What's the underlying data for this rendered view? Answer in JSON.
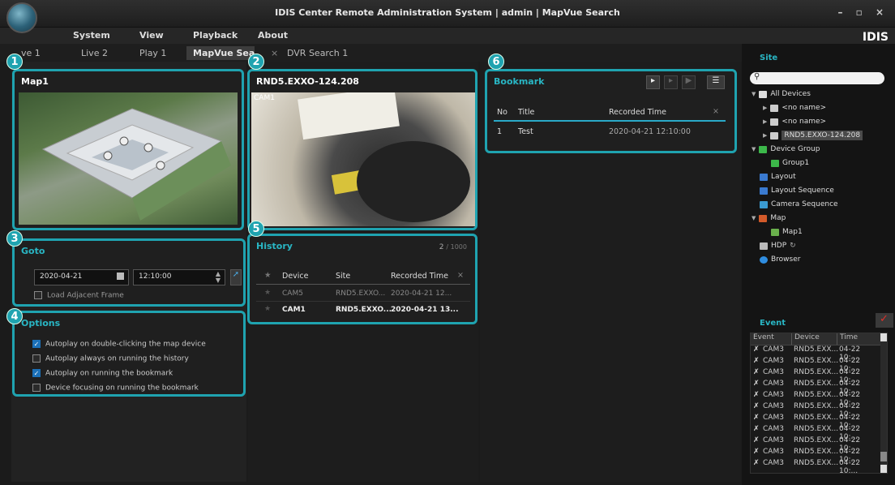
{
  "window": {
    "title": "IDIS Center Remote Administration System | admin | MapVue Search",
    "controls": "– ▫ ×"
  },
  "menu": {
    "items": [
      "System",
      "View",
      "Playback",
      "About"
    ],
    "brand": "IDIS"
  },
  "tabs": [
    {
      "label": "ve 1"
    },
    {
      "label": "Live 2"
    },
    {
      "label": "Play 1"
    },
    {
      "label": "MapVue Search"
    },
    {
      "label": "DVR Search 1"
    }
  ],
  "close_tab_glyph": "×",
  "map_panel": {
    "title": "Map1",
    "badge": "1"
  },
  "camera_panel": {
    "title": "RND5.EXXO-124.208",
    "overlay": "CAM1",
    "badge": "2"
  },
  "goto_panel": {
    "title": "Goto",
    "badge": "3",
    "date": "2020-04-21",
    "time": "12:10:00",
    "load_adjacent": "Load Adjacent Frame"
  },
  "options_panel": {
    "title": "Options",
    "badge": "4",
    "items": [
      {
        "label": "Autoplay on double-clicking the map device",
        "checked": true
      },
      {
        "label": "Autoplay always on running the history",
        "checked": false
      },
      {
        "label": "Autoplay on running the bookmark",
        "checked": true
      },
      {
        "label": "Device focusing on running the bookmark",
        "checked": false
      }
    ]
  },
  "history_panel": {
    "title": "History",
    "badge": "5",
    "count": "2",
    "total": "/ 1000",
    "columns": [
      "Device",
      "Site",
      "Recorded Time"
    ],
    "rows": [
      {
        "device": "CAM5",
        "site": "RND5.EXXO...",
        "time": "2020-04-21 12..."
      },
      {
        "device": "CAM1",
        "site": "RND5.EXXO...",
        "time": "2020-04-21 13..."
      }
    ]
  },
  "bookmark_panel": {
    "title": "Bookmark",
    "badge": "6",
    "columns": [
      "No",
      "Title",
      "Recorded Time"
    ],
    "rows": [
      {
        "no": "1",
        "title": "Test",
        "time": "2020-04-21 12:10:00"
      }
    ]
  },
  "site": {
    "title": "Site",
    "search_placeholder": "",
    "tree": [
      {
        "label": "All Devices",
        "icon": "folder-icon"
      },
      {
        "label": "<no name>",
        "icon": "device-icon"
      },
      {
        "label": "<no name>",
        "icon": "device-icon"
      },
      {
        "label": "RND5.EXXO-124.208",
        "icon": "device-icon"
      },
      {
        "label": "Device Group",
        "icon": "group-icon"
      },
      {
        "label": "Group1",
        "icon": "group-icon"
      },
      {
        "label": "Layout",
        "icon": "layout-icon"
      },
      {
        "label": "Layout Sequence",
        "icon": "layout-sequence-icon"
      },
      {
        "label": "Camera Sequence",
        "icon": "camera-sequence-icon"
      },
      {
        "label": "Map",
        "icon": "map-icon"
      },
      {
        "label": "Map1",
        "icon": "map-icon"
      },
      {
        "label": "HDP",
        "icon": "hdp-icon"
      },
      {
        "label": "Browser",
        "icon": "browser-icon"
      }
    ]
  },
  "event": {
    "title": "Event",
    "columns": [
      "Event",
      "Device",
      "Time"
    ],
    "rows": [
      {
        "event": "CAM3",
        "device": "RND5.EXX...",
        "time": "04-22 10:..."
      },
      {
        "event": "CAM3",
        "device": "RND5.EXX...",
        "time": "04-22 10:..."
      },
      {
        "event": "CAM3",
        "device": "RND5.EXX...",
        "time": "04-22 10:..."
      },
      {
        "event": "CAM3",
        "device": "RND5.EXX...",
        "time": "04-22 10:..."
      },
      {
        "event": "CAM3",
        "device": "RND5.EXX...",
        "time": "04-22 10:..."
      },
      {
        "event": "CAM3",
        "device": "RND5.EXX...",
        "time": "04-22 10:..."
      },
      {
        "event": "CAM3",
        "device": "RND5.EXX...",
        "time": "04-22 10:..."
      },
      {
        "event": "CAM3",
        "device": "RND5.EXX...",
        "time": "04-22 10:..."
      },
      {
        "event": "CAM3",
        "device": "RND5.EXX...",
        "time": "04-22 10:..."
      },
      {
        "event": "CAM3",
        "device": "RND5.EXX...",
        "time": "04-22 10:..."
      },
      {
        "event": "CAM3",
        "device": "RND5.EXX...",
        "time": "04-22 10:..."
      }
    ]
  },
  "colors": {
    "accent": "#1fa3b0",
    "bookmark_line": "#2aa9c8",
    "event_alert": "#e0302a"
  }
}
